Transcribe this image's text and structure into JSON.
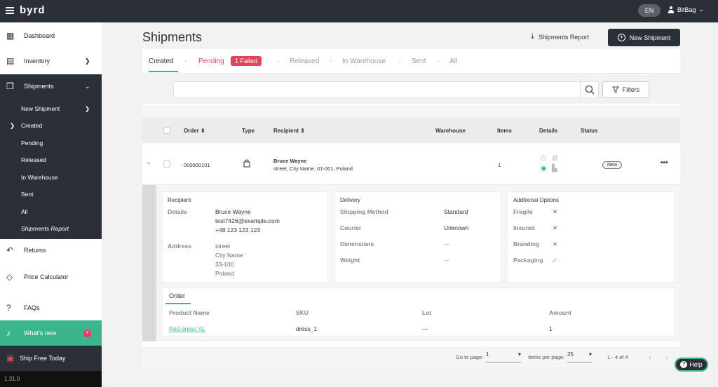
{
  "app": {
    "logo": "byrd",
    "language": "EN",
    "user": "BitBag",
    "version": "1.31.0"
  },
  "sidebar": {
    "dashboard": "Dashboard",
    "inventory": "Inventory",
    "shipments": "Shipments",
    "sub_items": [
      "New Shipment",
      "Created",
      "Pending",
      "Released",
      "In Warehouse",
      "Sent",
      "All",
      "Shipments Report"
    ],
    "returns": "Returns",
    "price_calculator": "Price Calculator",
    "faqs": "FAQs",
    "whats_new": "What's new",
    "whats_new_count": "4",
    "ship_free": "Ship Free Today"
  },
  "header": {
    "title": "Shipments",
    "report_button": "Shipments Report",
    "new_button": "New Shipment"
  },
  "tabs": {
    "created": "Created",
    "pending": "Pending",
    "failed": "1 Failed",
    "released": "Released",
    "in_warehouse": "In Warehouse",
    "sent": "Sent",
    "all": "All"
  },
  "search": {
    "placeholder": "",
    "filters_label": "Filters"
  },
  "table": {
    "headers": {
      "order": "Order",
      "type": "Type",
      "recipient": "Recipient",
      "warehouse": "Warehouse",
      "items": "Items",
      "details": "Details",
      "status": "Status"
    },
    "row": {
      "order": "000000101",
      "recipient_name": "Bruce Wayne",
      "recipient_address": "street, City Name, 01-001, Poland",
      "items": "1",
      "status": "New"
    }
  },
  "details": {
    "recipient": {
      "title": "Recipient",
      "details_label": "Details",
      "name": "Bruce Wayne",
      "email": "test7426@example.com",
      "phone": "+48 123 123 123",
      "address_label": "Address",
      "street": "street",
      "city": "City Name",
      "postal": "33-100",
      "country": "Poland"
    },
    "delivery": {
      "title": "Delivery",
      "shipping_method_label": "Shipping Method",
      "shipping_method": "Standard",
      "courier_label": "Courier",
      "courier": "Unknown",
      "dimensions_label": "Dimensions",
      "dimensions": "—",
      "weight_label": "Weight",
      "weight": "—"
    },
    "options": {
      "title": "Additional Options",
      "fragile_label": "Fragile",
      "fragile": "✕",
      "insured_label": "Insured",
      "insured": "✕",
      "branding_label": "Branding",
      "branding": "✕",
      "packaging_label": "Packaging",
      "packaging": "✓"
    },
    "order": {
      "tab": "Order",
      "headers": {
        "product": "Product Name",
        "sku": "SKU",
        "lot": "Lot",
        "amount": "Amount"
      },
      "row": {
        "product": "Red dress XL",
        "sku": "dress_1",
        "lot": "—",
        "amount": "1"
      }
    }
  },
  "pager": {
    "go_to_label": "Go to page:",
    "go_to_value": "1",
    "per_page_label": "Items per page:",
    "per_page_value": "25",
    "range": "1 - 4 of 4"
  },
  "help": "Help",
  "colors": {
    "accent": "#3cb58f",
    "dark": "#2b3038",
    "danger": "#e2445c"
  }
}
